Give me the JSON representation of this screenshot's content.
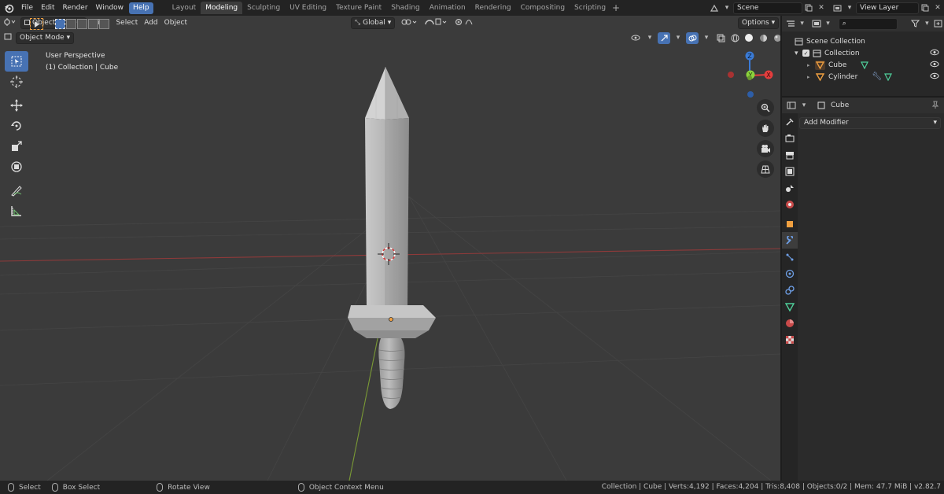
{
  "topbar": {
    "menus": [
      "File",
      "Edit",
      "Render",
      "Window",
      "Help"
    ],
    "active_menu": "Help",
    "workspaces": [
      "Layout",
      "Modeling",
      "Sculpting",
      "UV Editing",
      "Texture Paint",
      "Shading",
      "Animation",
      "Rendering",
      "Compositing",
      "Scripting"
    ],
    "active_workspace": "Modeling",
    "scene_name": "Scene",
    "view_layer": "View Layer"
  },
  "viewport": {
    "mode": "Object Mode",
    "menus": [
      "View",
      "Select",
      "Add",
      "Object"
    ],
    "orientation": "Global",
    "options_label": "Options",
    "info_line1": "User Perspective",
    "info_line2": "(1) Collection | Cube",
    "gizmo_axes": {
      "x": "X",
      "y": "Y",
      "z": "Z"
    }
  },
  "outliner": {
    "root": "Scene Collection",
    "collection": "Collection",
    "objects": [
      "Cube",
      "Cylinder"
    ]
  },
  "properties": {
    "object_name": "Cube",
    "add_modifier": "Add Modifier"
  },
  "statusbar": {
    "select": "Select",
    "box_select": "Box Select",
    "rotate_view": "Rotate View",
    "context_menu": "Object Context Menu",
    "stats": "Collection | Cube | Verts:4,192 | Faces:4,204 | Tris:8,408 | Objects:0/2 | Mem: 47.7 MiB | v2.82.7"
  },
  "colors": {
    "accent": "#4772b3",
    "viewport_bg": "#3b3b3b",
    "x_axis": "#e43d3d",
    "y_axis": "#8bd33c",
    "z_axis": "#3a7bd6",
    "origin": "#f0a040"
  }
}
